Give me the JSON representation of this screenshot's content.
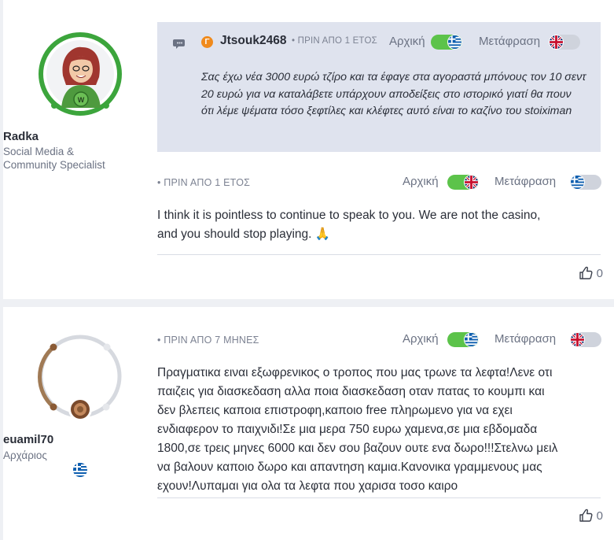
{
  "post1": {
    "author": {
      "name": "Radka",
      "role_line1": "Social Media &",
      "role_line2": "Community Specialist"
    },
    "quote": {
      "avatar_letter": "Γ",
      "username": "Jtsouk2468",
      "meta": "• ΠΡΙΝ ΑΠΟ 1 ΕΤΟΣ",
      "original_label": "Αρχική",
      "translate_label": "Μετάφραση",
      "text": "Σας έχω νέα 3000 ευρώ τζίρο και τα έφαγε στα αγοραστά μπόνους τον 10 σεντ 20 ευρώ για να καταλάβετε υπάρχουν αποδείξεις στο ιστορικό γιατί θα πουν ότι λέμε ψέματα τόσο ξεφτίλες και κλέφτες αυτό είναι το καζίνο του stoiximan"
    },
    "meta": "• ΠΡΙΝ ΑΠΟ 1 ΕΤΟΣ",
    "original_label": "Αρχική",
    "translate_label": "Μετάφραση",
    "text_line1": "I think it is pointless to continue to speak to you. We are not the casino,",
    "text_line2": "and you should stop playing. 🙏",
    "likes": "0"
  },
  "post2": {
    "author": {
      "name": "euamil70",
      "rank": "Αρχάριος"
    },
    "meta": "• ΠΡΙΝ ΑΠΟ 7 ΜΗΝΕΣ",
    "original_label": "Αρχική",
    "translate_label": "Μετάφραση",
    "lines": [
      "Πραγματικα ειναι εξωφρενικος ο τροπος που μας τρωνε τα λεφτα!Λενε οτι",
      "παιζεις για διασκεδαση αλλα ποια διασκεδαση οταν πατας το κουμπι και",
      "δεν βλεπεις καποια επιστροφη,καποιο free πληρωμενο για να εχει",
      "ενδιαφερον το παιχνιδι!Σε μια μερα 750 ευρω χαμενα,σε μια εβδομαδα",
      "1800,σε τρεις μηνες 6000 και δεν σου βαζουν ουτε ενα δωρο!!!Στελνω μειλ",
      "να βαλουν καποιο δωρο και απαντηση καμια.Κανονικα γραμμενους μας",
      "εχουν!Λυπαμαι για ολα τα λεφτα που χαρισα τοσο καιρο"
    ],
    "likes": "0"
  },
  "icons": {
    "quote": "speech-bubbles-icon",
    "like": "thumbs-up-icon",
    "flags": [
      "greek-flag-icon",
      "uk-flag-icon"
    ]
  },
  "colors": {
    "toggle_on": "#5cc34a",
    "toggle_off": "#cfd3dc",
    "staff_ring": "#3ca53c",
    "quote_bg": "#dfe3ee",
    "quote_avatar": "#f08a1c"
  }
}
